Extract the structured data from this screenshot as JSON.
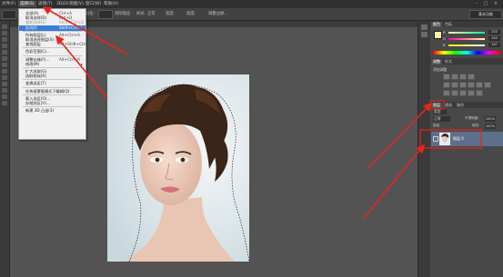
{
  "app": {
    "menus": [
      "文件(F)",
      "编辑(E)",
      "图像(I)",
      "图层(L)",
      "类型(Y)",
      "选择(S)",
      "滤镜(T)",
      "3D(D)",
      "视图(V)",
      "窗口(W)",
      "帮助(H)"
    ],
    "window_buttons": [
      "–",
      "□",
      "×"
    ]
  },
  "options_bar": {
    "items": [
      "羽化:",
      "消除锯齿",
      "样式:",
      "正常",
      "宽度:",
      "高度:",
      "调整边缘..."
    ],
    "workspace": "基本功能"
  },
  "doc_tab": {
    "title": ""
  },
  "select_menu": {
    "items": [
      {
        "label": "全部(A)",
        "shortcut": "Ctrl+A",
        "state": "normal",
        "submenu": false
      },
      {
        "label": "取消选择(D)",
        "shortcut": "Ctrl+D",
        "state": "normal",
        "submenu": false
      },
      {
        "label": "重新选择(E)",
        "shortcut": "Shift+Ctrl+D",
        "state": "disabled",
        "submenu": false
      },
      {
        "label": "反向(I)",
        "shortcut": "Shift+Ctrl+I",
        "state": "highlighted",
        "submenu": false
      },
      {
        "sep": true
      },
      {
        "label": "所有图层(L)",
        "shortcut": "Alt+Ctrl+A",
        "state": "normal",
        "submenu": false
      },
      {
        "label": "取消选择图层(S)",
        "shortcut": "",
        "state": "normal",
        "submenu": false
      },
      {
        "label": "查找图层",
        "shortcut": "Alt+Shift+Ctrl+F",
        "state": "normal",
        "submenu": false
      },
      {
        "sep": true
      },
      {
        "label": "色彩范围(C)...",
        "shortcut": "",
        "state": "normal",
        "submenu": false
      },
      {
        "sep": true
      },
      {
        "label": "调整边缘(F)...",
        "shortcut": "Alt+Ctrl+R",
        "state": "normal",
        "submenu": false
      },
      {
        "label": "修改(M)",
        "shortcut": "",
        "state": "normal",
        "submenu": true
      },
      {
        "sep": true
      },
      {
        "label": "扩大选取(G)",
        "shortcut": "",
        "state": "normal",
        "submenu": false
      },
      {
        "label": "选取相似(R)",
        "shortcut": "",
        "state": "normal",
        "submenu": false
      },
      {
        "sep": true
      },
      {
        "label": "变换选区(T)",
        "shortcut": "",
        "state": "normal",
        "submenu": false
      },
      {
        "sep": true
      },
      {
        "label": "在快速蒙版模式下编辑(Q)",
        "shortcut": "",
        "state": "normal",
        "submenu": false
      },
      {
        "sep": true
      },
      {
        "label": "载入选区(O)...",
        "shortcut": "",
        "state": "normal",
        "submenu": false
      },
      {
        "label": "存储选区(V)...",
        "shortcut": "",
        "state": "normal",
        "submenu": false
      },
      {
        "sep": true
      },
      {
        "label": "新建 3D 凸出(3)",
        "shortcut": "",
        "state": "normal",
        "submenu": false
      }
    ]
  },
  "color_panel": {
    "tabs": [
      "颜色",
      "色板"
    ],
    "sliders": [
      {
        "label": "R",
        "value": "255",
        "color": "#d83a3a"
      },
      {
        "label": "G",
        "value": "240",
        "color": "#3ab04a"
      },
      {
        "label": "B",
        "value": "167",
        "color": "#3a6ad8"
      }
    ],
    "fg_color": "#fff0a7",
    "bg_color": "#ffffff"
  },
  "adjustments_panel": {
    "tabs": [
      "调整",
      "样式"
    ],
    "subtitle": "添加调整"
  },
  "layers_panel": {
    "tabs": [
      "图层",
      "通道",
      "路径"
    ],
    "kind_label": "类型",
    "blend_mode": "正常",
    "opacity_label": "不透明度:",
    "opacity_value": "100%",
    "lock_label": "锁定:",
    "fill_label": "填充:",
    "fill_value": "100%",
    "layer_name": "图层 0"
  },
  "accent": {
    "highlight": "#3a7fd4",
    "arrow": "#e8241a",
    "selected_layer": "#5d6f8b"
  }
}
